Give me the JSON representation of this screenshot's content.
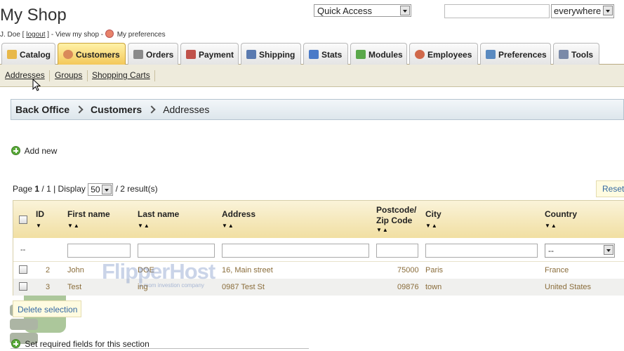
{
  "header": {
    "shop_title": "My Shop",
    "user_name": "J. Doe [",
    "logout": "logout",
    "after_logout": "] - View my shop -",
    "my_preferences": "My preferences",
    "quick_access": "Quick Access",
    "search_value": "",
    "search_scope": "everywhere"
  },
  "tabs": [
    {
      "label": "Catalog",
      "icon": "folder-icon",
      "color": "#e8b84a"
    },
    {
      "label": "Customers",
      "icon": "user-icon",
      "color": "#d98a5a"
    },
    {
      "label": "Orders",
      "icon": "cart-icon",
      "color": "#8a8a8a"
    },
    {
      "label": "Payment",
      "icon": "payment-icon",
      "color": "#c0524a"
    },
    {
      "label": "Shipping",
      "icon": "truck-icon",
      "color": "#5a7ab0"
    },
    {
      "label": "Stats",
      "icon": "chart-icon",
      "color": "#4a7ac8"
    },
    {
      "label": "Modules",
      "icon": "puzzle-icon",
      "color": "#5aa84a"
    },
    {
      "label": "Employees",
      "icon": "employee-icon",
      "color": "#d0684a"
    },
    {
      "label": "Preferences",
      "icon": "preferences-icon",
      "color": "#5a8ac0"
    },
    {
      "label": "Tools",
      "icon": "wrench-icon",
      "color": "#7a8aa8"
    }
  ],
  "subtabs": [
    "Addresses",
    "Groups",
    "Shopping Carts"
  ],
  "breadcrumb": [
    "Back Office",
    "Customers",
    "Addresses"
  ],
  "actions": {
    "add_new": "Add new",
    "reset": "Reset",
    "delete_selection": "Delete selection",
    "required_fields": "Set required fields for this section"
  },
  "pager": {
    "page_label": "Page",
    "page": "1",
    "pages": "/ 1 | Display",
    "display": "50",
    "results": "/ 2 result(s)"
  },
  "table": {
    "headers": {
      "id": "ID",
      "first_name": "First name",
      "last_name": "Last name",
      "address": "Address",
      "postcode_1": "Postcode/",
      "postcode_2": "Zip Code",
      "city": "City",
      "country": "Country"
    },
    "filter_id": "--",
    "filter_country": "--",
    "rows": [
      {
        "id": "2",
        "first_name": "John",
        "last_name": "DOE",
        "address": "16, Main street",
        "postcode": "75000",
        "city": "Paris",
        "country": "France"
      },
      {
        "id": "3",
        "first_name": "Test",
        "last_name": "ing",
        "address": "0987 Test St",
        "postcode": "09876",
        "city": "town",
        "country": "United States"
      }
    ]
  },
  "watermark": {
    "brand": "FlipperHost",
    "tagline": "a mom investion company"
  },
  "colors": {
    "active_tab": "#f3c85a",
    "table_header": "#f1dfa2",
    "link": "#3369a3",
    "data_text": "#8a6d3b"
  }
}
